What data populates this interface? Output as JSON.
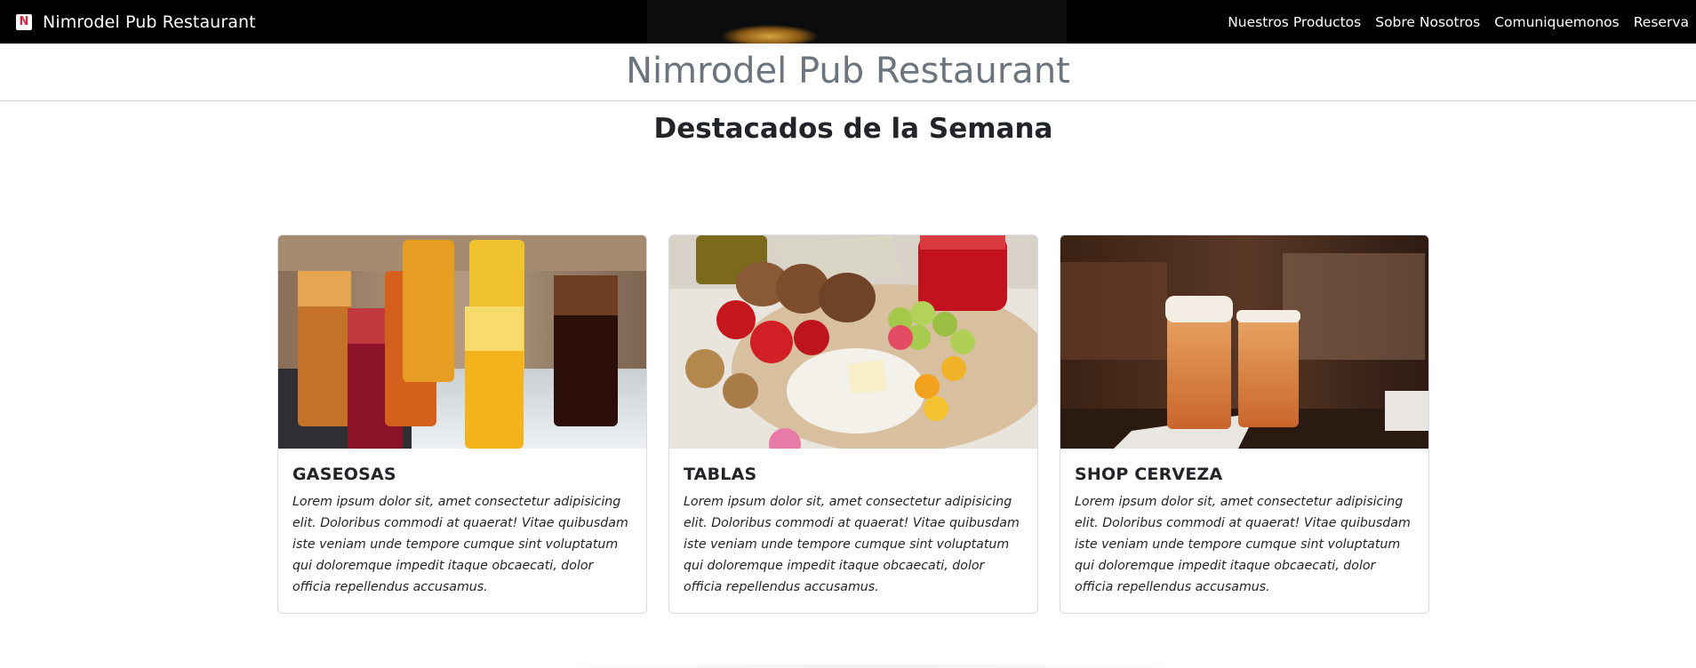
{
  "navbar": {
    "brand_logo_letter": "N",
    "brand_name": "Nimrodel Pub Restaurant",
    "links": [
      {
        "label": "Nuestros Productos"
      },
      {
        "label": "Sobre Nosotros"
      },
      {
        "label": "Comuniquemonos"
      },
      {
        "label": "Reserva"
      }
    ]
  },
  "header": {
    "site_title": "Nimrodel Pub Restaurant"
  },
  "section": {
    "title": "Destacados de la Semana"
  },
  "cards": [
    {
      "image_alt": "Vasos de bebidas gaseosas con hielo",
      "title": "GASEOSAS",
      "text": "Lorem ipsum dolor sit, amet consectetur adipisicing elit. Doloribus commodi at quaerat! Vitae quibusdam iste veniam unde tempore cumque sint voluptatum qui doloremque impedit itaque obcaecati, dolor officia repellendus accusamus."
    },
    {
      "image_alt": "Tabla de quesos, frutas y frutos secos",
      "title": "TABLAS",
      "text": "Lorem ipsum dolor sit, amet consectetur adipisicing elit. Doloribus commodi at quaerat! Vitae quibusdam iste veniam unde tempore cumque sint voluptatum qui doloremque impedit itaque obcaecati, dolor officia repellendus accusamus."
    },
    {
      "image_alt": "Dos vasos de cerveza en la barra",
      "title": "SHOP CERVEZA",
      "text": "Lorem ipsum dolor sit, amet consectetur adipisicing elit. Doloribus commodi at quaerat! Vitae quibusdam iste veniam unde tempore cumque sint voluptatum qui doloremque impedit itaque obcaecati, dolor officia repellendus accusamus."
    }
  ],
  "colors": {
    "navbar_bg": "#000000",
    "title_gray": "#6c757d",
    "text_dark": "#212529",
    "logo_red": "#d7263d"
  }
}
